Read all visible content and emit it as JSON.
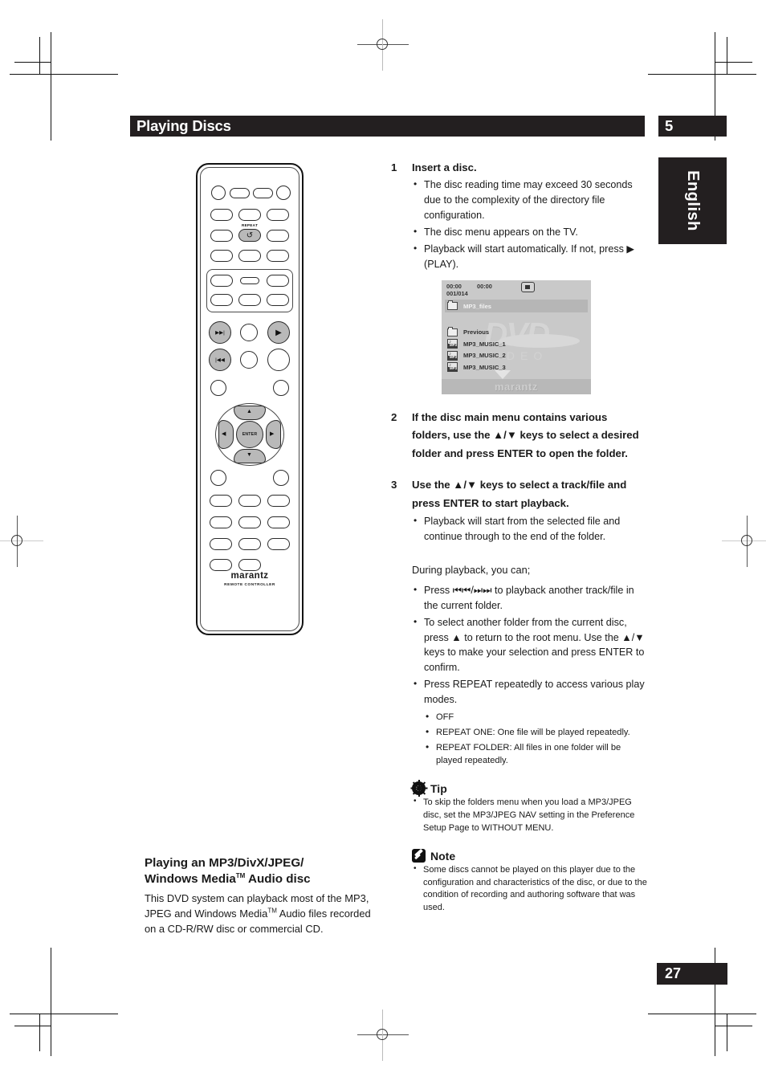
{
  "header": {
    "title": "Playing Discs",
    "chapter": "5",
    "language_tab": "English",
    "page_number": "27"
  },
  "steps": [
    {
      "num": "1",
      "title": "Insert a disc.",
      "bullets": [
        "The disc reading time may exceed 30 seconds due to the complexity of the directory file configuration.",
        "The disc menu appears on the TV.",
        "Playback will start automatically. If not, press ▶ (PLAY)."
      ]
    },
    {
      "num": "2",
      "title": "If the disc main menu contains various folders, use the ▲/▼ keys to select a desired folder and press ENTER to open the folder.",
      "bullets": []
    },
    {
      "num": "3",
      "title": "Use the ▲/▼ keys to select a track/file and press ENTER to start playback.",
      "bullets": [
        "Playback will start from the selected file and continue through to the end of the folder."
      ]
    }
  ],
  "during_playback": {
    "intro": "During playback, you can;",
    "bullets": [
      "Press ⏮⏮/⏭⏭ to playback another track/file in the current folder.",
      "To select another folder from the current disc, press ▲ to return to the root menu. Use the ▲/▼ keys to make your selection and press ENTER to confirm.",
      "Press REPEAT repeatedly to access various play modes."
    ],
    "repeat_modes": [
      "OFF",
      "REPEAT ONE: One file will be played repeatedly.",
      "REPEAT FOLDER: All files in one folder will be played repeatedly."
    ]
  },
  "tv_screen": {
    "elapsed_time": "00:00",
    "total_time": "00:00",
    "track_counter": "001/014",
    "stop_icon": "stop-icon",
    "current_folder": "MP3_files",
    "watermark_main": "DVD",
    "watermark_sub": "VIDEO",
    "brand": "marantz",
    "items": [
      {
        "icon": "folder-icon",
        "label": "Previous"
      },
      {
        "icon": "mp3-file-icon",
        "label": "MP3_MUSIC_1"
      },
      {
        "icon": "mp3-file-icon",
        "label": "MP3_MUSIC_2"
      },
      {
        "icon": "mp3-file-icon",
        "label": "MP3_MUSIC_3"
      }
    ],
    "scroll_indicator": "down-arrow-icon"
  },
  "tip": {
    "icon": "gear-icon",
    "title": "Tip",
    "bullets": [
      "To skip the folders menu when you load a MP3/JPEG disc, set the MP3/JPEG NAV setting in the Preference Setup Page to WITHOUT MENU."
    ]
  },
  "note": {
    "icon": "pencil-icon",
    "title": "Note",
    "bullets": [
      "Some discs cannot be played on this player due to the configuration and characteristics of the disc, or due to the condition of recording and authoring software that was used."
    ]
  },
  "left_section": {
    "heading_line1": "Playing an MP3/DivX/JPEG/",
    "heading_line2_a": "Windows Media",
    "heading_tm": "TM",
    "heading_line2_b": " Audio disc",
    "body_a": "This DVD system can playback most of the MP3, JPEG and Windows Media",
    "body_tm": "TM",
    "body_b": " Audio files recorded on a CD-R/RW disc or commercial CD."
  },
  "remote": {
    "brand": "marantz",
    "subtitle": "REMOTE CONTROLLER",
    "repeat_label": "REPEAT",
    "repeat_glyph": "↺",
    "enter_label": "ENTER",
    "next_glyph": "▶▶|",
    "prev_glyph": "|◀◀",
    "play_glyph": "▶",
    "up_glyph": "▲",
    "down_glyph": "▼",
    "left_glyph": "◀",
    "right_glyph": "▶"
  },
  "colors": {
    "ink": "#231f20",
    "screen_bg": "#c9c9c9",
    "button_grey": "#b9b9b9"
  }
}
